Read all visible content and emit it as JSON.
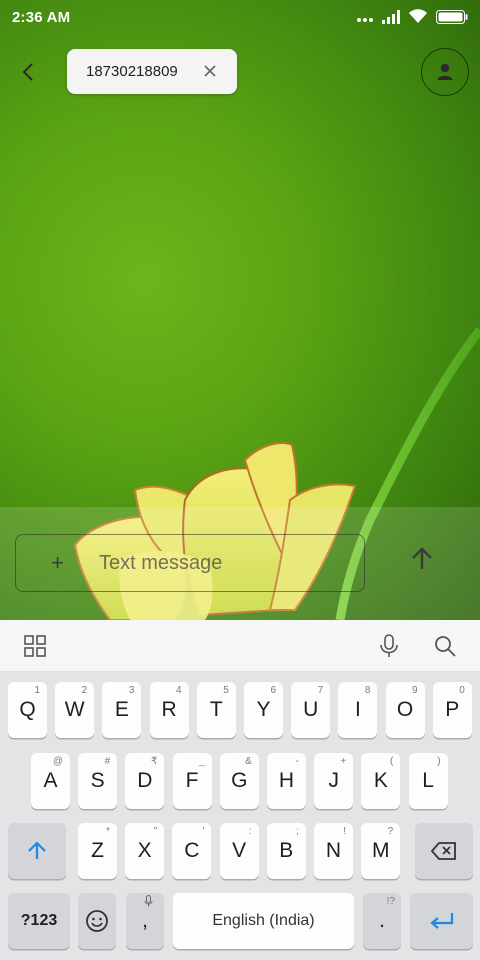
{
  "status_bar": {
    "time": "2:36 AM",
    "icons": [
      "dots-icon",
      "signal-icon",
      "wifi-icon",
      "battery-icon"
    ]
  },
  "header": {
    "back_icon": "back-arrow-icon",
    "recipient": "18730218809",
    "remove_icon": "close-icon",
    "contact_icon": "person-icon"
  },
  "compose": {
    "add_label": "+",
    "placeholder": "Text message",
    "send_icon": "up-arrow-icon"
  },
  "keyboard_toolbar": {
    "icons": [
      "grid-icon",
      "mic-icon",
      "search-icon"
    ]
  },
  "keyboard": {
    "row1": [
      {
        "key": "Q",
        "hint": "1"
      },
      {
        "key": "W",
        "hint": "2"
      },
      {
        "key": "E",
        "hint": "3"
      },
      {
        "key": "R",
        "hint": "4"
      },
      {
        "key": "T",
        "hint": "5"
      },
      {
        "key": "Y",
        "hint": "6"
      },
      {
        "key": "U",
        "hint": "7"
      },
      {
        "key": "I",
        "hint": "8"
      },
      {
        "key": "O",
        "hint": "9"
      },
      {
        "key": "P",
        "hint": "0"
      }
    ],
    "row2": [
      {
        "key": "A",
        "hint": "@"
      },
      {
        "key": "S",
        "hint": "#"
      },
      {
        "key": "D",
        "hint": "₹"
      },
      {
        "key": "F",
        "hint": "_"
      },
      {
        "key": "G",
        "hint": "&"
      },
      {
        "key": "H",
        "hint": "-"
      },
      {
        "key": "J",
        "hint": "+"
      },
      {
        "key": "K",
        "hint": "("
      },
      {
        "key": "L",
        "hint": ")"
      }
    ],
    "row3": [
      {
        "key": "Z",
        "hint": "*"
      },
      {
        "key": "X",
        "hint": "\""
      },
      {
        "key": "C",
        "hint": "'"
      },
      {
        "key": "V",
        "hint": ":"
      },
      {
        "key": "B",
        "hint": ";"
      },
      {
        "key": "N",
        "hint": "!"
      },
      {
        "key": "M",
        "hint": "?"
      }
    ],
    "symbols_label": "?123",
    "comma_label": ",",
    "space_label": "English (India)",
    "period_label": ".",
    "period_hint": "!?",
    "accent_color": "#1e88e5"
  }
}
